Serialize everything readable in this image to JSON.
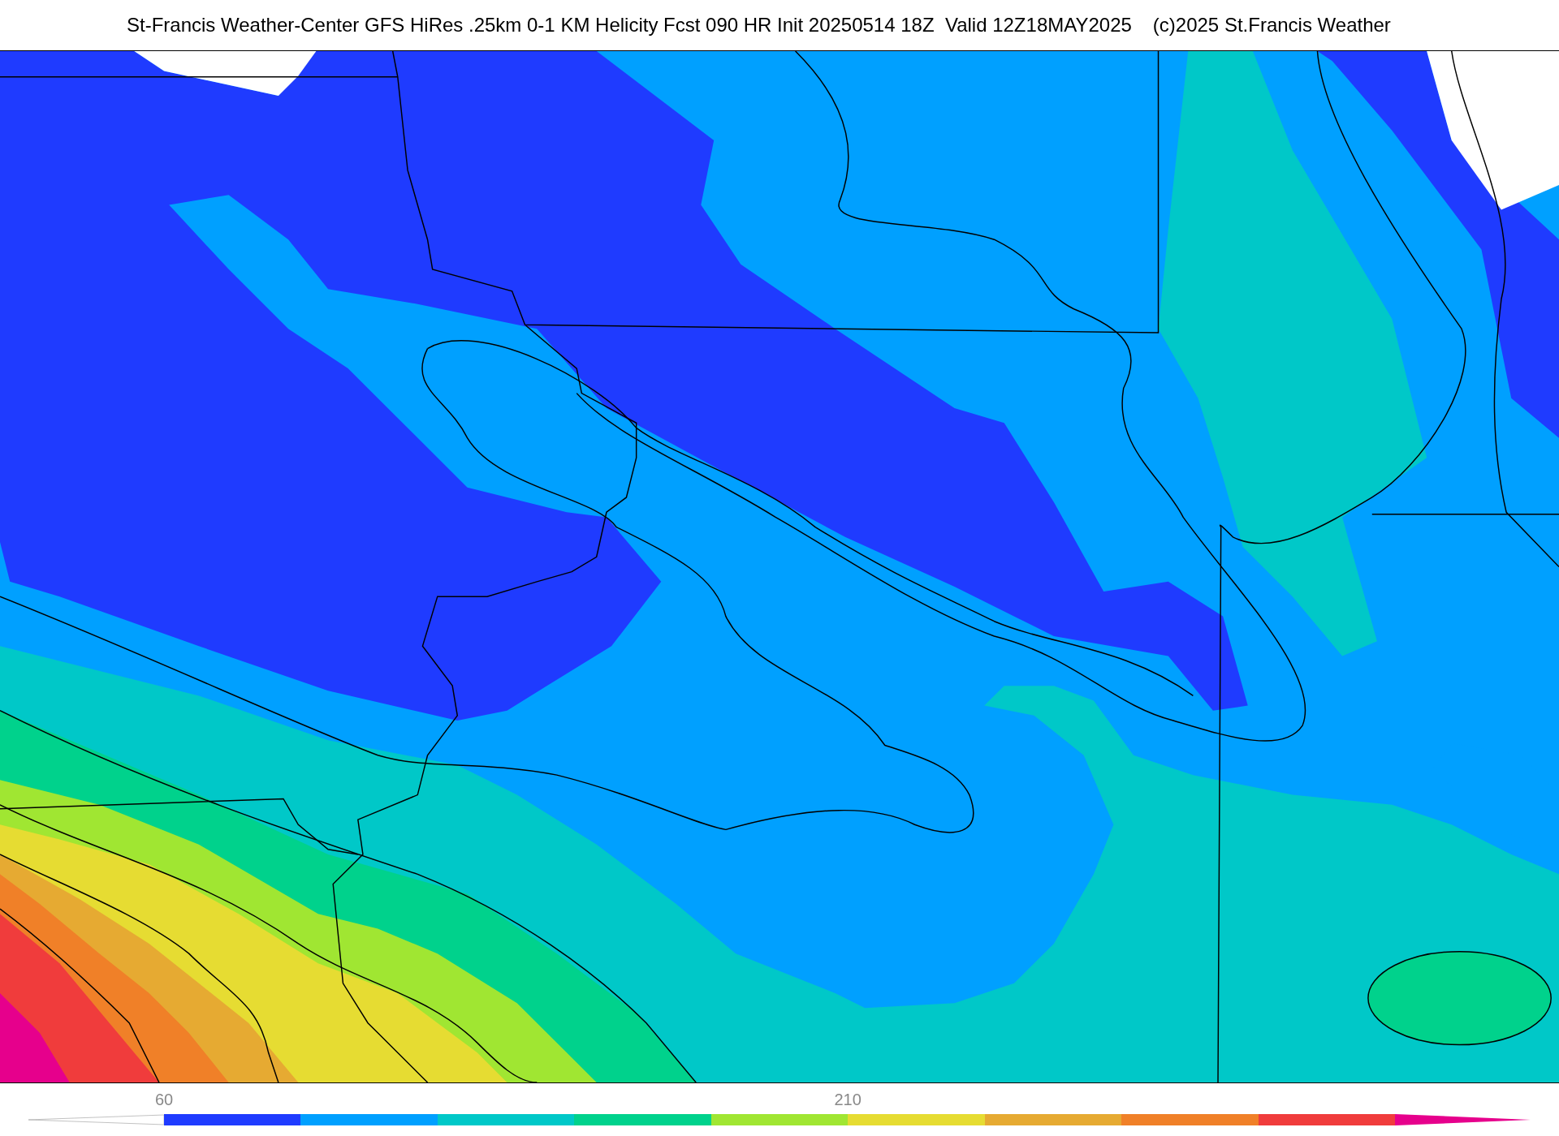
{
  "title": {
    "text": "St-Francis Weather-Center GFS HiRes .25km 0-1 KM Helicity Fcst 090 HR Init 20250514 18Z  Valid 12Z18MAY2025",
    "credit": "(c)2025 St.Francis Weather"
  },
  "colorbar": {
    "under": {
      "color": "#ffffff"
    },
    "bins": [
      {
        "color": "#1f3bff",
        "label": "60"
      },
      {
        "color": "#00a0ff"
      },
      {
        "color": "#00c8c8"
      },
      {
        "color": "#00d28c"
      },
      {
        "color": "#a0e632"
      },
      {
        "color": "#e6dc32",
        "label": "210"
      },
      {
        "color": "#e6aa32"
      },
      {
        "color": "#f08028"
      },
      {
        "color": "#f03c3c"
      }
    ],
    "over": {
      "color": "#e6008c"
    }
  }
}
